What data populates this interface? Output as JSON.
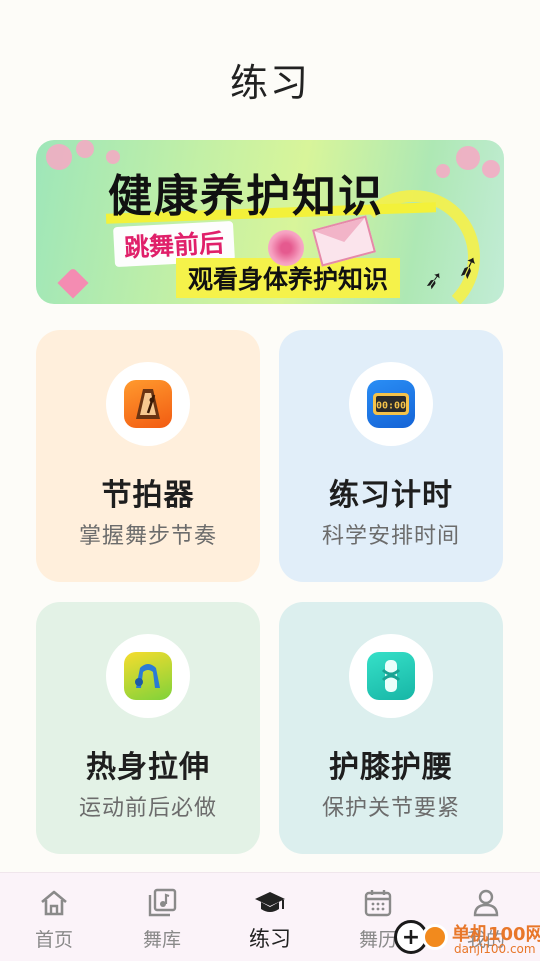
{
  "page": {
    "title": "练习"
  },
  "banner": {
    "headline": "健康养护知识",
    "tag1": "跳舞前后",
    "tag2": "观看身体养护知识"
  },
  "cards": [
    {
      "id": "metronome",
      "title": "节拍器",
      "subtitle": "掌握舞步节奏",
      "icon": "metronome-icon",
      "color": "#ffefdc"
    },
    {
      "id": "timer",
      "title": "练习计时",
      "subtitle": "科学安排时间",
      "icon": "timer-icon",
      "color": "#e1eef9"
    },
    {
      "id": "warmup",
      "title": "热身拉伸",
      "subtitle": "运动前后必做",
      "icon": "stretch-icon",
      "color": "#e3f2e6"
    },
    {
      "id": "knee",
      "title": "护膝护腰",
      "subtitle": "保护关节要紧",
      "icon": "knee-icon",
      "color": "#dcefee"
    }
  ],
  "tabs": [
    {
      "label": "首页",
      "icon": "home-icon",
      "active": false
    },
    {
      "label": "舞库",
      "icon": "music-library-icon",
      "active": false
    },
    {
      "label": "练习",
      "icon": "graduation-cap-icon",
      "active": true
    },
    {
      "label": "舞历",
      "icon": "calendar-icon",
      "active": false
    },
    {
      "label": "我的",
      "icon": "user-icon",
      "active": false
    }
  ],
  "watermark": {
    "text": "单机100网",
    "url": "danji100.com"
  }
}
